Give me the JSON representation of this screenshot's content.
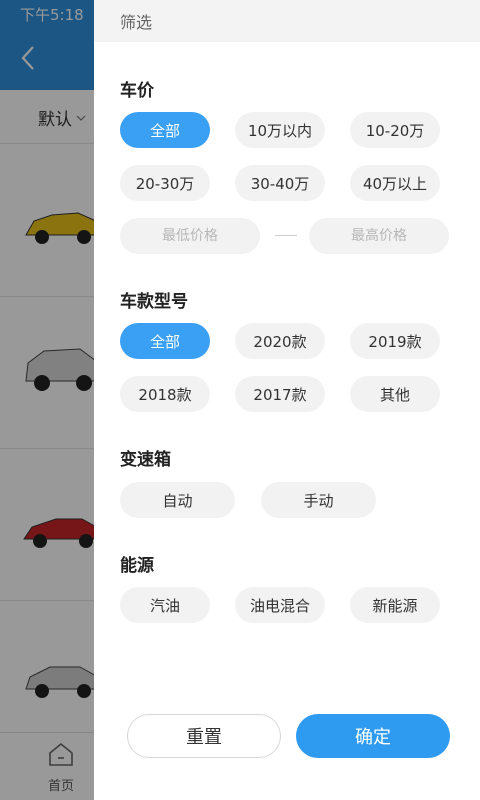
{
  "status_bar": {
    "time": "下午5:18"
  },
  "background": {
    "sort_label": "默认",
    "tabbar": {
      "home_label": "首页"
    },
    "car_colors": [
      "#e8c21a",
      "#d8d8d8",
      "#c7262a",
      "#cfcfcf"
    ]
  },
  "drawer": {
    "title": "筛选",
    "price": {
      "title": "车价",
      "options": [
        "全部",
        "10万以内",
        "10-20万",
        "20-30万",
        "30-40万",
        "40万以上"
      ],
      "selected": "全部",
      "min_placeholder": "最低价格",
      "max_placeholder": "最高价格"
    },
    "model_year": {
      "title": "车款型号",
      "options": [
        "全部",
        "2020款",
        "2019款",
        "2018款",
        "2017款",
        "其他"
      ],
      "selected": "全部"
    },
    "gearbox": {
      "title": "变速箱",
      "options": [
        "自动",
        "手动"
      ]
    },
    "energy": {
      "title": "能源",
      "options": [
        "汽油",
        "油电混合",
        "新能源"
      ]
    },
    "buttons": {
      "reset": "重置",
      "confirm": "确定"
    }
  },
  "colors": {
    "accent": "#3aa0f3",
    "header_blue": "#2f8fdd",
    "chip_bg": "#f2f2f2"
  }
}
